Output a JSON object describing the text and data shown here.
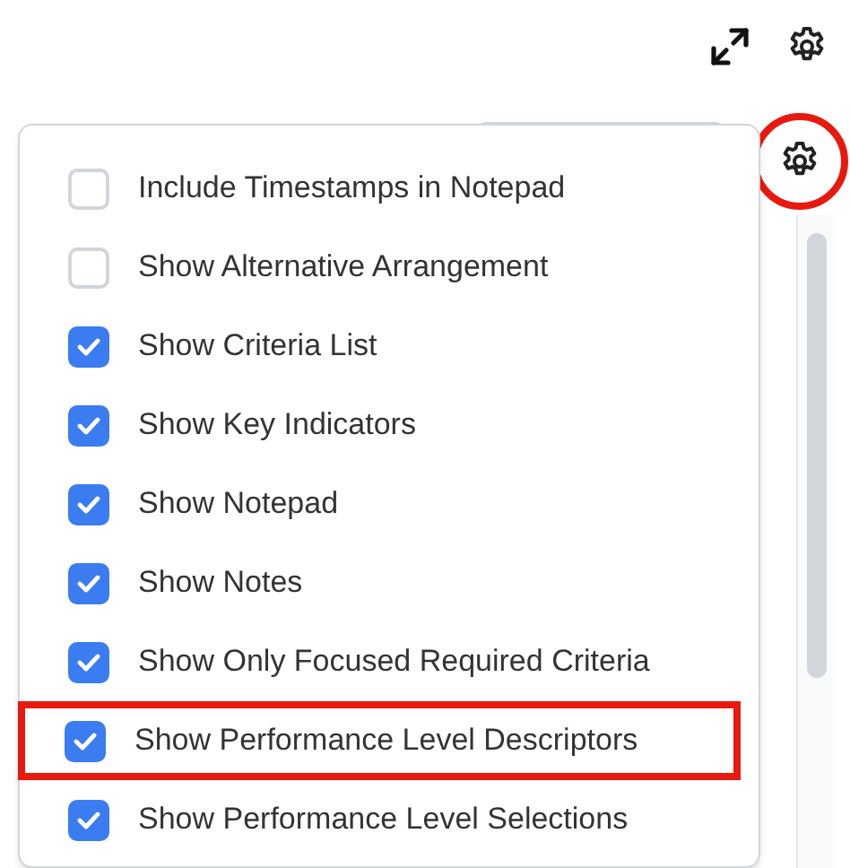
{
  "toolbar": {
    "buttons": [
      {
        "kind": "expand"
      },
      {
        "kind": "settings"
      }
    ]
  },
  "settings_button": {
    "highlighted": true
  },
  "settings_menu": {
    "items": [
      {
        "label": "Include Timestamps in Notepad",
        "checked": false,
        "highlighted": false
      },
      {
        "label": "Show Alternative Arrangement",
        "checked": false,
        "highlighted": false
      },
      {
        "label": "Show Criteria List",
        "checked": true,
        "highlighted": false
      },
      {
        "label": "Show Key Indicators",
        "checked": true,
        "highlighted": false
      },
      {
        "label": "Show Notepad",
        "checked": true,
        "highlighted": false
      },
      {
        "label": "Show Notes",
        "checked": true,
        "highlighted": false
      },
      {
        "label": "Show Only Focused Required Criteria",
        "checked": true,
        "highlighted": false
      },
      {
        "label": "Show Performance Level Descriptors",
        "checked": true,
        "highlighted": true
      },
      {
        "label": "Show Performance Level Selections",
        "checked": true,
        "highlighted": false
      }
    ]
  }
}
